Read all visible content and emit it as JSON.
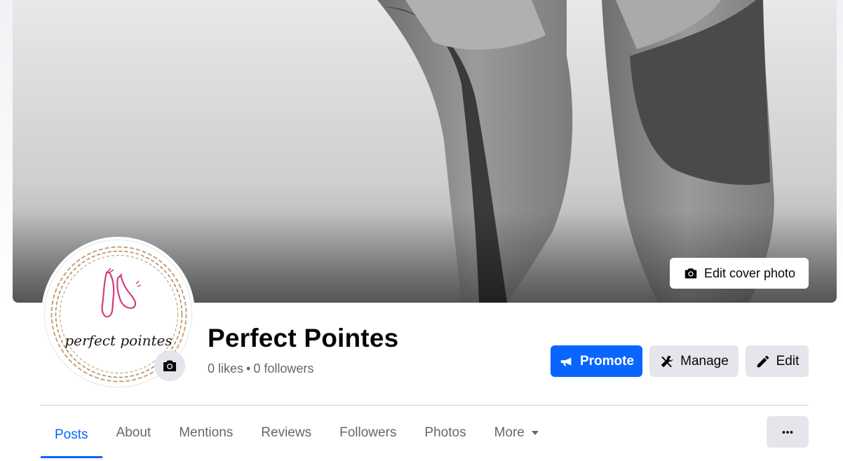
{
  "colors": {
    "primary": "#0866ff",
    "button_grey": "#e4e6eb",
    "secondary_text": "#65676b"
  },
  "cover": {
    "image": "black-and-white pointe shoes photo",
    "edit_label": "Edit cover photo",
    "edit_icon": "camera-icon"
  },
  "profile": {
    "avatar_logo_text": "perfect pointes",
    "avatar_icon": "camera-icon",
    "name": "Perfect Pointes",
    "likes": "0 likes",
    "separator": "•",
    "followers": "0 followers"
  },
  "actions": {
    "promote": {
      "label": "Promote",
      "icon": "megaphone-icon"
    },
    "manage": {
      "label": "Manage",
      "icon": "tools-icon"
    },
    "edit": {
      "label": "Edit",
      "icon": "pencil-icon"
    }
  },
  "tabs": [
    {
      "label": "Posts",
      "active": true
    },
    {
      "label": "About"
    },
    {
      "label": "Mentions"
    },
    {
      "label": "Reviews"
    },
    {
      "label": "Followers"
    },
    {
      "label": "Photos"
    },
    {
      "label": "More",
      "icon": "caret-down-icon"
    }
  ],
  "overflow_menu_icon": "ellipsis-icon"
}
